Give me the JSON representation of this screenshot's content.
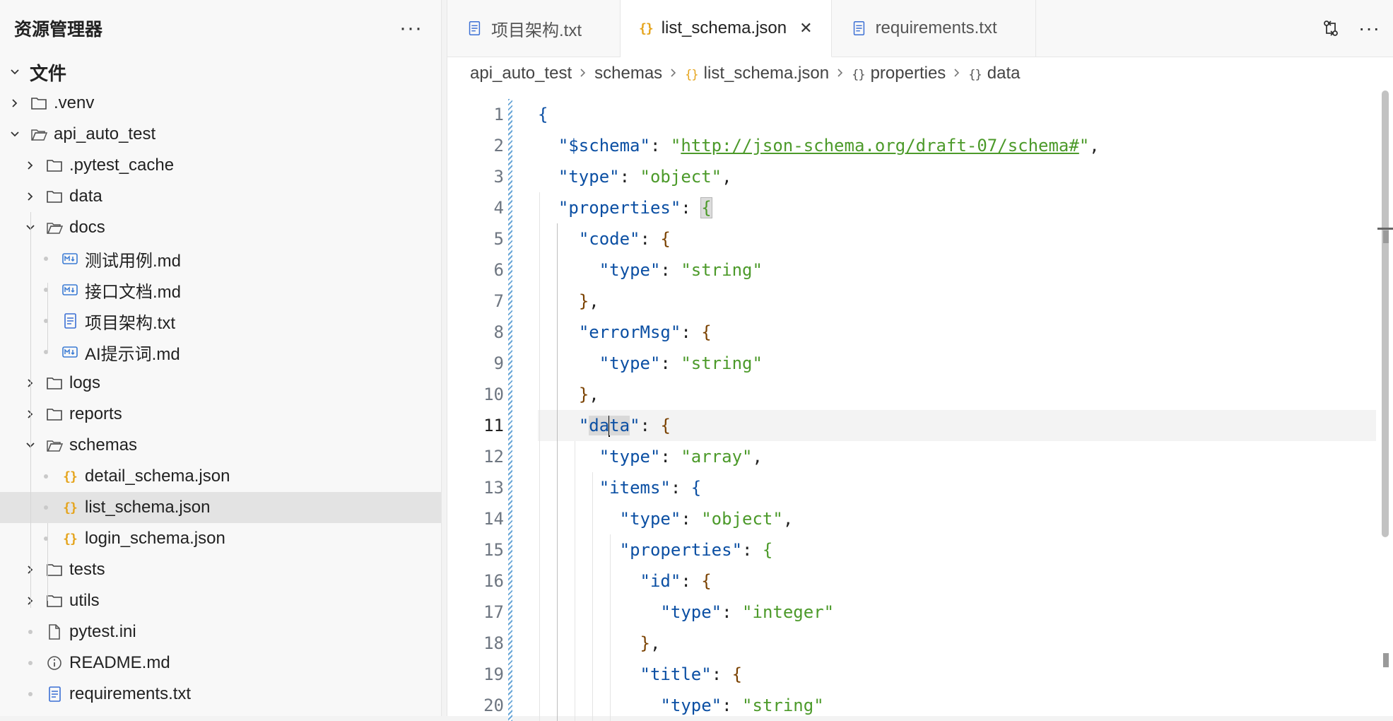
{
  "explorer": {
    "title": "资源管理器",
    "more_label": "···",
    "section": "文件",
    "items": [
      {
        "label": ".venv",
        "kind": "folder",
        "state": "collapsed",
        "depth": 1
      },
      {
        "label": "api_auto_test",
        "kind": "folder",
        "state": "expanded",
        "depth": 1
      },
      {
        "label": ".pytest_cache",
        "kind": "folder",
        "state": "collapsed",
        "depth": 2
      },
      {
        "label": "data",
        "kind": "folder",
        "state": "collapsed",
        "depth": 2
      },
      {
        "label": "docs",
        "kind": "folder",
        "state": "expanded",
        "depth": 2
      },
      {
        "label": "测试用例.md",
        "kind": "markdown",
        "depth": 3
      },
      {
        "label": "接口文档.md",
        "kind": "markdown",
        "depth": 3
      },
      {
        "label": "项目架构.txt",
        "kind": "text",
        "depth": 3
      },
      {
        "label": "AI提示词.md",
        "kind": "markdown",
        "depth": 3
      },
      {
        "label": "logs",
        "kind": "folder",
        "state": "collapsed",
        "depth": 2
      },
      {
        "label": "reports",
        "kind": "folder",
        "state": "collapsed",
        "depth": 2
      },
      {
        "label": "schemas",
        "kind": "folder",
        "state": "expanded",
        "depth": 2
      },
      {
        "label": "detail_schema.json",
        "kind": "json",
        "depth": 3
      },
      {
        "label": "list_schema.json",
        "kind": "json",
        "depth": 3,
        "selected": true
      },
      {
        "label": "login_schema.json",
        "kind": "json",
        "depth": 3
      },
      {
        "label": "tests",
        "kind": "folder",
        "state": "collapsed",
        "depth": 2
      },
      {
        "label": "utils",
        "kind": "folder",
        "state": "collapsed",
        "depth": 2
      },
      {
        "label": "pytest.ini",
        "kind": "file",
        "depth": 2
      },
      {
        "label": "README.md",
        "kind": "info",
        "depth": 2
      },
      {
        "label": "requirements.txt",
        "kind": "text",
        "depth": 2
      }
    ]
  },
  "tabs": [
    {
      "label": "项目架构.txt",
      "icon": "text-file-icon"
    },
    {
      "label": "list_schema.json",
      "icon": "json-file-icon",
      "active": true,
      "close": "✕"
    },
    {
      "label": "requirements.txt",
      "icon": "text-file-icon"
    }
  ],
  "breadcrumb": [
    {
      "label": "api_auto_test",
      "icon": ""
    },
    {
      "label": "schemas",
      "icon": ""
    },
    {
      "label": "list_schema.json",
      "icon": "{}"
    },
    {
      "label": "properties",
      "icon": "{}"
    },
    {
      "label": "data",
      "icon": "{}"
    }
  ],
  "editor": {
    "current_line": 11,
    "line_numbers": [
      "1",
      "2",
      "3",
      "4",
      "5",
      "6",
      "7",
      "8",
      "9",
      "10",
      "11",
      "12",
      "13",
      "14",
      "15",
      "16",
      "17",
      "18",
      "19",
      "20"
    ],
    "lines": [
      "{",
      "  \"$schema\": \"http://json-schema.org/draft-07/schema#\",",
      "  \"type\": \"object\",",
      "  \"properties\": {",
      "    \"code\": {",
      "      \"type\": \"string\"",
      "    },",
      "    \"errorMsg\": {",
      "      \"type\": \"string\"",
      "    },",
      "    \"data\": {",
      "      \"type\": \"array\",",
      "      \"items\": {",
      "        \"type\": \"object\",",
      "        \"properties\": {",
      "          \"id\": {",
      "            \"type\": \"integer\"",
      "          },",
      "          \"title\": {",
      "            \"type\": \"string\""
    ]
  },
  "colors": {
    "key": "#0b4fa3",
    "string": "#4c9a2a",
    "json_icon": "#e5a41c",
    "markdown_icon": "#3b7bd4"
  }
}
